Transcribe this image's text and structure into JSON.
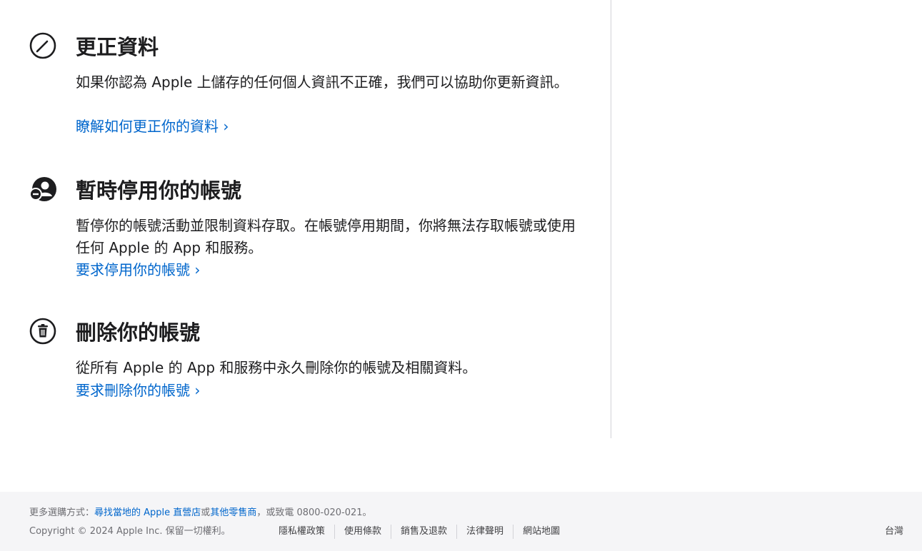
{
  "sections": [
    {
      "title": "更正資料",
      "icon": "pencil-circle-icon",
      "description": "如果你認為 Apple 上儲存的任何個人資訊不正確，我們可以協助你更新資訊。",
      "link": "瞭解如何更正你的資料 ›"
    },
    {
      "title": "暫時停用你的帳號",
      "icon": "person-minus-icon",
      "description": "暫停你的帳號活動並限制資料存取。在帳號停用期間，你將無法存取帳號或使用任何 Apple 的 App 和服務。",
      "link": "要求停用你的帳號 ›"
    },
    {
      "title": "刪除你的帳號",
      "icon": "trash-circle-icon",
      "description": "從所有 Apple 的 App 和服務中永久刪除你的帳號及相關資料。",
      "link": "要求刪除你的帳號 ›"
    }
  ],
  "footer": {
    "shop_prefix": "更多選購方式：",
    "find_store_link": "尋找當地的 Apple 直營店",
    "or_text": "或",
    "retailer_link": "其他零售商",
    "call_text": "，或致電 0800-020-021。",
    "copyright": "Copyright © 2024 Apple Inc. 保留一切權利。",
    "legal_links": [
      "隱私權政策",
      "使用條款",
      "銷售及退款",
      "法律聲明",
      "網站地圖"
    ],
    "region": "台灣"
  },
  "colors": {
    "link": "#0066cc",
    "text": "#1d1d1f",
    "footer_bg": "#f5f5f7",
    "divider": "#d2d2d7"
  }
}
